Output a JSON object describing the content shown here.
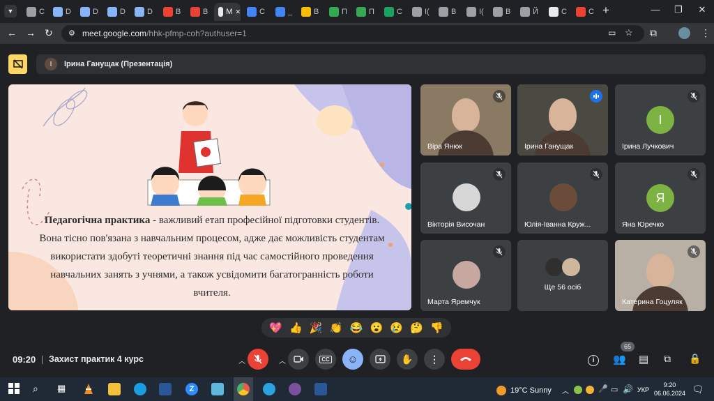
{
  "browser": {
    "tabs": [
      {
        "label": "C",
        "color": "#9aa0a6"
      },
      {
        "label": "D",
        "color": "#8ab4f8"
      },
      {
        "label": "D",
        "color": "#8ab4f8"
      },
      {
        "label": "D",
        "color": "#8ab4f8"
      },
      {
        "label": "D",
        "color": "#8ab4f8"
      },
      {
        "label": "B",
        "color": "#ea4335"
      },
      {
        "label": "B",
        "color": "#ea4335"
      },
      {
        "label": "M",
        "color": "#e8eaed"
      },
      {
        "label": "C",
        "color": "#4285f4"
      },
      {
        "label": "_",
        "color": "#4285f4"
      },
      {
        "label": "B",
        "color": "#fbbc04"
      },
      {
        "label": "П",
        "color": "#34a853"
      },
      {
        "label": "П",
        "color": "#34a853"
      },
      {
        "label": "C",
        "color": "#1aa260"
      },
      {
        "label": "I(",
        "color": "#9aa0a6"
      },
      {
        "label": "B",
        "color": "#9aa0a6"
      },
      {
        "label": "I(",
        "color": "#9aa0a6"
      },
      {
        "label": "B",
        "color": "#9aa0a6"
      },
      {
        "label": "Й",
        "color": "#9aa0a6"
      },
      {
        "label": "C",
        "color": "#e8eaed"
      },
      {
        "label": "C",
        "color": "#ea4335"
      }
    ],
    "new_tab": "+",
    "url_host": "meet.google.com",
    "url_path": "/hhk-pfmp-coh?authuser=1"
  },
  "meet": {
    "presenter_avatar": "I",
    "presenter_label": "Ірина Ганущак (Презентація)",
    "slide": {
      "heading": "Педагогічна практика",
      "text": " - важливий етап професійної підготовки студентів. Вона тісно пов'язана з навчальним процесом, адже дає можливість студентам використати здобуті теоретичні знання під час самостійного проведення навчальних занять з учнями, а також усвідомити багатогранність роботи вчителя."
    },
    "participants": [
      {
        "name": "Віра Янюк",
        "type": "video",
        "bg": "#8b7a63",
        "muted": true
      },
      {
        "name": "Ірина Ганущак",
        "type": "video",
        "bg": "#4a4a42",
        "speaking": true
      },
      {
        "name": "Ірина Лучкович",
        "type": "letter",
        "letter": "I",
        "color": "#7cb342",
        "muted": true
      },
      {
        "name": "Вікторія Височан",
        "type": "photo",
        "bg": "#d7d7d7",
        "muted": true
      },
      {
        "name": "Юлія-Іванна Круж...",
        "type": "photo",
        "bg": "#6b4c3b",
        "muted": true
      },
      {
        "name": "Яна Юречко",
        "type": "letter",
        "letter": "Я",
        "color": "#7cb342",
        "muted": true
      },
      {
        "name": "Марта Яремчук",
        "type": "photo",
        "bg": "#c6a8a0",
        "muted": true
      },
      {
        "name": "Ще 56 осіб",
        "type": "more"
      },
      {
        "name": "Катерина Гоцуляк",
        "type": "video",
        "bg": "#b8b0a4",
        "muted": true
      }
    ],
    "reactions": [
      "💖",
      "👍",
      "🎉",
      "👏",
      "😂",
      "😮",
      "😢",
      "🤔",
      "👎"
    ],
    "time": "09:20",
    "meeting_name": "Захист практик 4 курс",
    "participant_count": "65",
    "accent_red": "#ea4335",
    "accent_blue": "#8ab4f8"
  },
  "taskbar": {
    "weather_temp": "19°C",
    "weather_text": "Sunny",
    "language": "УКР",
    "clock_time": "9:20",
    "clock_date": "06.06.2024"
  }
}
